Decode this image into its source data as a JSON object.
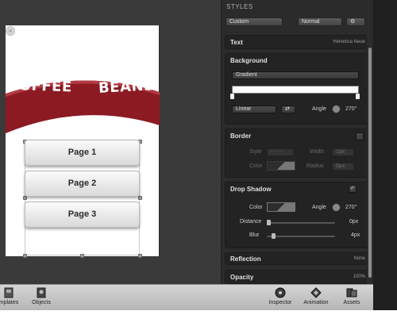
{
  "canvas": {
    "close_glyph": "×",
    "banner": {
      "left_text": "COFFEE",
      "right_text": "BEANS",
      "color": "#8b1a22"
    },
    "pages": [
      "Page 1",
      "Page 2",
      "Page 3"
    ]
  },
  "inspector": {
    "title": "STYLES",
    "style_preset": "Custom",
    "text_style": "Normal",
    "sections": {
      "text": {
        "label": "Text",
        "value": "Helvetica Neue"
      },
      "background": {
        "label": "Background",
        "fill_type": "Gradient",
        "gradient_type": "Linear",
        "angle_label": "Angle",
        "angle_value": "270°"
      },
      "border": {
        "label": "Border",
        "style_label": "Style",
        "width_label": "Width",
        "color_label": "Color",
        "radius_label": "Radius",
        "width_value": "1px",
        "radius_value": "0px"
      },
      "drop_shadow": {
        "label": "Drop Shadow",
        "color_label": "Color",
        "angle_label": "Angle",
        "angle_value": "270°",
        "distance_label": "Distance",
        "distance_value": "0px",
        "blur_label": "Blur",
        "blur_value": "4px"
      },
      "reflection": {
        "label": "Reflection",
        "value": "None"
      },
      "opacity": {
        "label": "Opacity",
        "value": "100%"
      }
    }
  },
  "toolbar": {
    "templates_label": "mplates",
    "objects_label": "Objects",
    "inspector_label": "Inspector",
    "animation_label": "Animation",
    "assets_label": "Assets"
  }
}
